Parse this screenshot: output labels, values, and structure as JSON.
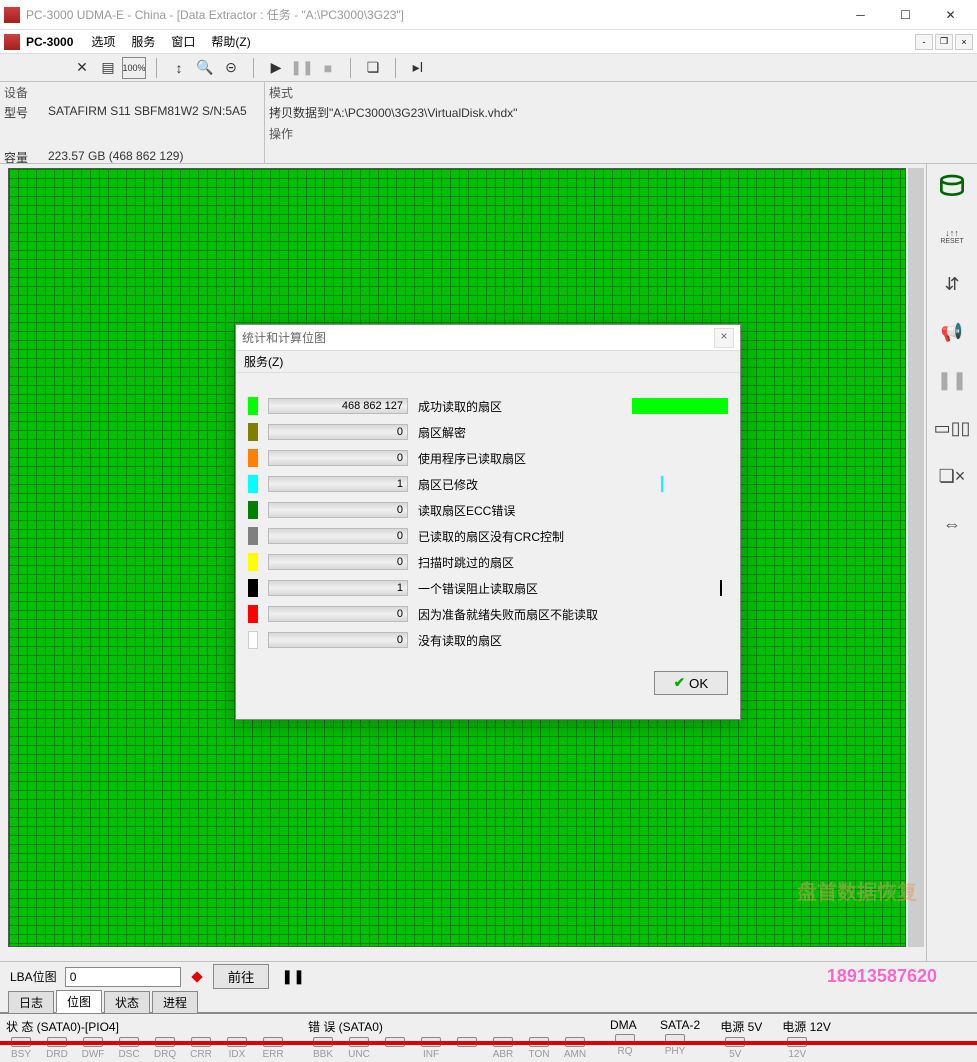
{
  "titlebar": {
    "title": "PC-3000 UDMA-E - China - [Data Extractor : 任务 - \"A:\\PC3000\\3G23\"]"
  },
  "menubar": {
    "brand": "PC-3000",
    "items": [
      "选项",
      "服务",
      "窗口",
      "帮助(Z)"
    ]
  },
  "device_panel": {
    "title": "设备",
    "model_label": "型号",
    "model_value": "SATAFIRM   S11 SBFM81W2 S/N:5A5",
    "capacity_label": "容量",
    "capacity_value": "223.57 GB (468 862 129)"
  },
  "mode_panel": {
    "mode_label": "模式",
    "mode_value": "拷贝数据到\"A:\\PC3000\\3G23\\VirtualDisk.vhdx\"",
    "op_label": "操作",
    "op_value": ""
  },
  "dialog": {
    "title": "统计和计算位图",
    "menu": "服务(Z)",
    "rows": [
      {
        "color": "#00ff00",
        "value": "468 862 127",
        "label": "成功读取的扇区",
        "indicator": "full"
      },
      {
        "color": "#808000",
        "value": "0",
        "label": "扇区解密",
        "indicator": "none"
      },
      {
        "color": "#ff8000",
        "value": "0",
        "label": "使用程序已读取扇区",
        "indicator": "none"
      },
      {
        "color": "#00ffff",
        "value": "1",
        "label": "扇区已修改",
        "indicator": "tick",
        "tickColor": "#00ffff",
        "tickPos": "30%"
      },
      {
        "color": "#008000",
        "value": "0",
        "label": "读取扇区ECC错误",
        "indicator": "none"
      },
      {
        "color": "#808080",
        "value": "0",
        "label": "已读取的扇区没有CRC控制",
        "indicator": "none"
      },
      {
        "color": "#ffff00",
        "value": "0",
        "label": "扫描时跳过的扇区",
        "indicator": "none"
      },
      {
        "color": "#000000",
        "value": "1",
        "label": "一个错误阻止读取扇区",
        "indicator": "tick",
        "tickColor": "#000000",
        "tickPos": "92%"
      },
      {
        "color": "#ff0000",
        "value": "0",
        "label": "因为准备就绪失败而扇区不能读取",
        "indicator": "none"
      },
      {
        "color": "#ffffff",
        "value": "0",
        "label": "没有读取的扇区",
        "indicator": "none"
      }
    ],
    "ok": "OK"
  },
  "lba_bar": {
    "label": "LBA位图",
    "value": "0",
    "go": "前往"
  },
  "tabs": [
    "日志",
    "位图",
    "状态",
    "进程"
  ],
  "active_tab": 1,
  "status": {
    "groups": [
      {
        "title": "状 态 (SATA0)-[PIO4]",
        "leds": [
          "BSY",
          "DRD",
          "DWF",
          "DSC",
          "DRQ",
          "CRR",
          "IDX",
          "ERR"
        ]
      },
      {
        "title": "错 误 (SATA0)",
        "leds": [
          "BBK",
          "UNC",
          "",
          "INF",
          "",
          "ABR",
          "TON",
          "AMN"
        ]
      },
      {
        "title": "DMA",
        "leds": [
          "RQ"
        ]
      },
      {
        "title": "SATA-2",
        "leds": [
          "PHY"
        ]
      },
      {
        "title": "电源 5V",
        "leds": [
          "5V"
        ]
      },
      {
        "title": "电源 12V",
        "leds": [
          "12V"
        ]
      }
    ]
  },
  "watermark_top": "盘首数据恢复",
  "watermark": "18913587620"
}
